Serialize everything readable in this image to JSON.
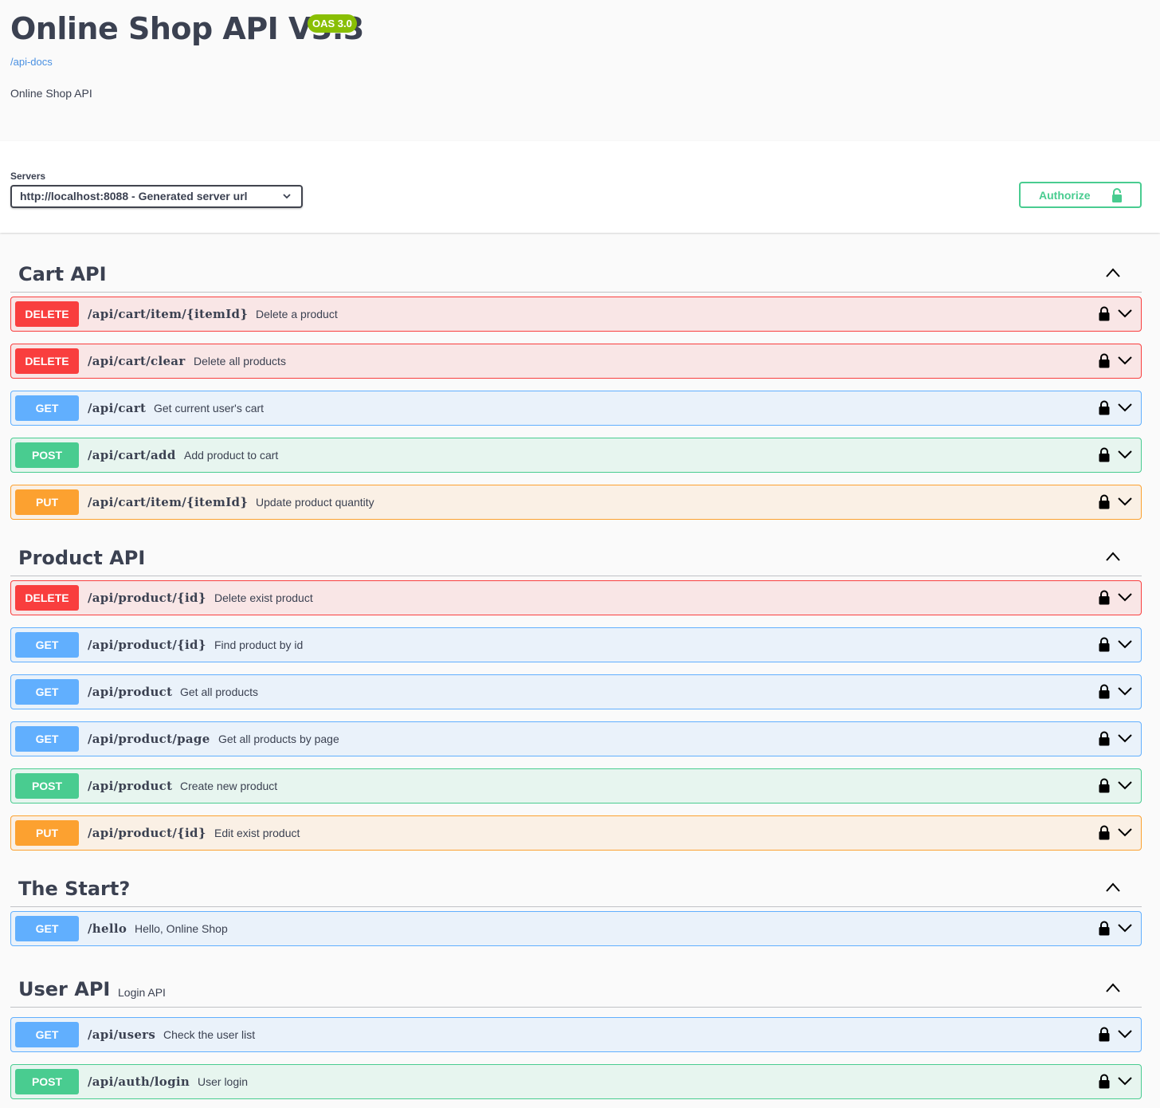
{
  "info": {
    "title": "Online Shop API V3.3",
    "oas_badge": "OAS 3.0",
    "docs_link": "/api-docs",
    "description": "Online Shop API"
  },
  "servers": {
    "label": "Servers",
    "selected": "http://localhost:8088 - Generated server url"
  },
  "authorize": {
    "label": "Authorize",
    "icon": "unlock-icon"
  },
  "colors": {
    "delete": "#f93e3e",
    "get": "#61affe",
    "post": "#49cc90",
    "put": "#fca130",
    "oas": "#89bf04"
  },
  "tags": [
    {
      "name": "Cart API",
      "description": "",
      "operations": [
        {
          "method": "DELETE",
          "path": "/api/cart/item/{itemId}",
          "summary": "Delete a product"
        },
        {
          "method": "DELETE",
          "path": "/api/cart/clear",
          "summary": "Delete all products"
        },
        {
          "method": "GET",
          "path": "/api/cart",
          "summary": "Get current user's cart"
        },
        {
          "method": "POST",
          "path": "/api/cart/add",
          "summary": "Add product to cart"
        },
        {
          "method": "PUT",
          "path": "/api/cart/item/{itemId}",
          "summary": "Update product quantity"
        }
      ]
    },
    {
      "name": "Product API",
      "description": "",
      "operations": [
        {
          "method": "DELETE",
          "path": "/api/product/{id}",
          "summary": "Delete exist product"
        },
        {
          "method": "GET",
          "path": "/api/product/{id}",
          "summary": "Find product by id"
        },
        {
          "method": "GET",
          "path": "/api/product",
          "summary": "Get all products"
        },
        {
          "method": "GET",
          "path": "/api/product/page",
          "summary": "Get all products by page"
        },
        {
          "method": "POST",
          "path": "/api/product",
          "summary": "Create new product"
        },
        {
          "method": "PUT",
          "path": "/api/product/{id}",
          "summary": "Edit exist product"
        }
      ]
    },
    {
      "name": "The Start?",
      "description": "",
      "operations": [
        {
          "method": "GET",
          "path": "/hello",
          "summary": "Hello, Online Shop"
        }
      ]
    },
    {
      "name": "User API",
      "description": "Login API",
      "operations": [
        {
          "method": "GET",
          "path": "/api/users",
          "summary": "Check the user list"
        },
        {
          "method": "POST",
          "path": "/api/auth/login",
          "summary": "User login"
        }
      ]
    }
  ]
}
